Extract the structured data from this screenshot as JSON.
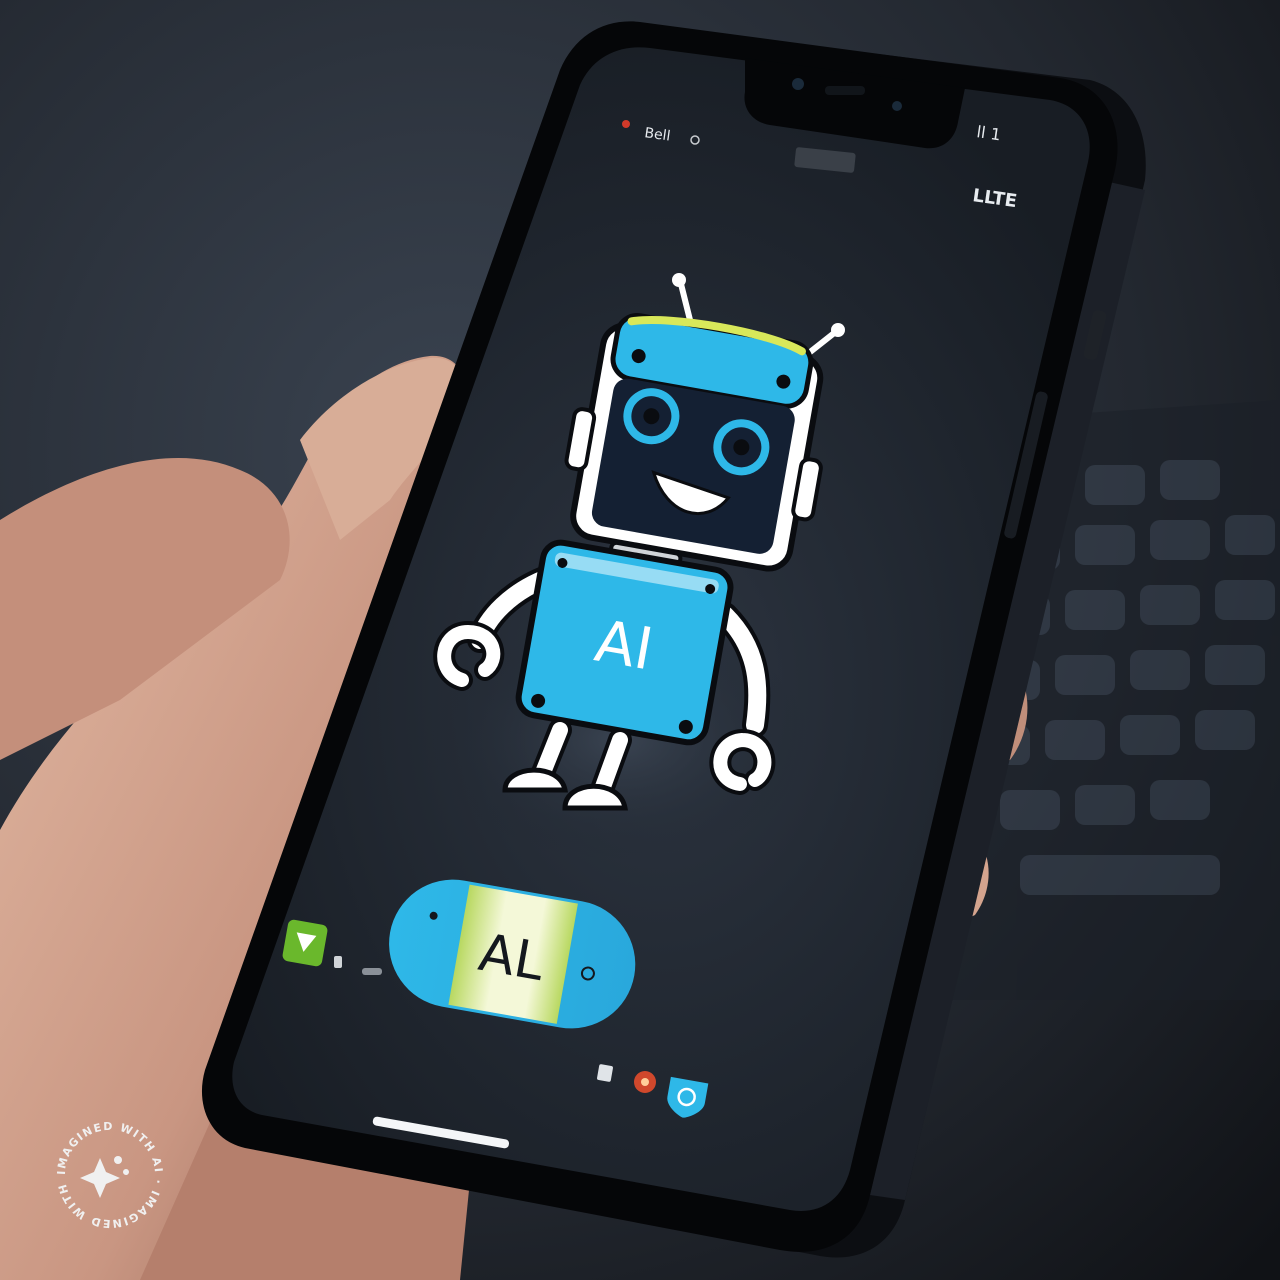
{
  "phone": {
    "status_left": "Bell",
    "status_right": "ll 1",
    "corner_readout": "LLTE",
    "robot_badge": "AI",
    "pill_label": "AL"
  },
  "watermark": {
    "ring_text": "IMAGINED WITH AI · IMAGINED WITH AI · "
  },
  "colors": {
    "accent_cyan": "#2eb8e8",
    "accent_yellow": "#d8e85a",
    "screen_bg": "#1f2630",
    "robot_dark": "#142033",
    "background": "#1a1e24"
  },
  "icons": {
    "left_dock": "green-play-icon",
    "bottom_right": [
      "square-icon",
      "red-dot-icon",
      "blue-shield-icon"
    ]
  }
}
